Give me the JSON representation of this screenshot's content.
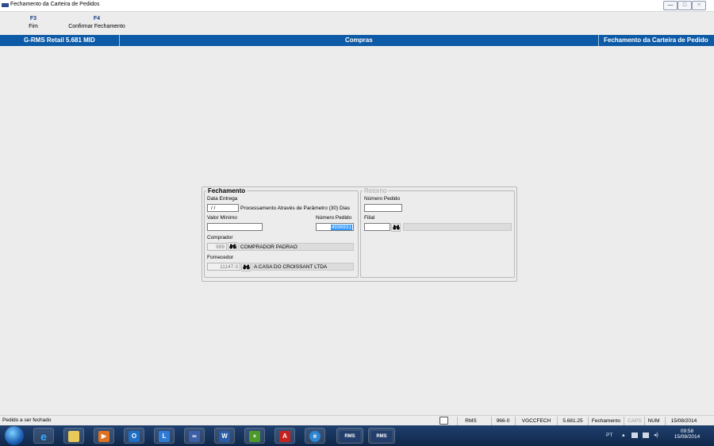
{
  "window": {
    "title": "Fechamento da Carteira de Pedidos",
    "btn_min": "—",
    "btn_max": "□",
    "btn_close": "✕"
  },
  "function_keys": [
    {
      "key": "F3",
      "label": "Fim"
    },
    {
      "key": "F4",
      "label": "Confirmar Fechamento"
    }
  ],
  "header": {
    "app": "G-RMS Retail 5.681 MID",
    "module": "Compras",
    "screen": "Fechamento da Carteira de Pedido"
  },
  "fechamento": {
    "title": "Fechamento",
    "data_entrega_label": "Data Entrega",
    "data_entrega_value": " / /",
    "processamento_text": "Processamento Através de Parâmetro (30) Dias",
    "valor_minimo_label": "Valor Mínimo",
    "valor_minimo_value": "",
    "numero_pedido_label": "Número Pedido",
    "numero_pedido_value": "4936931",
    "comprador_label": "Comprador",
    "comprador_code": "999",
    "comprador_name": "COMPRADOR PADRAO",
    "fornecedor_label": "Fornecedor",
    "fornecedor_code": "11147-3",
    "fornecedor_name": "A CASA DO CROISSANT LTDA"
  },
  "retorno": {
    "title": "Retorno",
    "numero_pedido_label": "Número Pedido",
    "filial_label": "Filial"
  },
  "status": {
    "message": "Pedido a ser fechado",
    "cells": [
      "RMS",
      "966-0",
      "VGCCFECH",
      "5.681.25",
      "Fechamento",
      "CAPS",
      "NUM",
      "15/08/2014"
    ]
  },
  "taskbar": {
    "apps": [
      "ie-icon",
      "explorer-icon",
      "media-icon",
      "outlook-icon",
      "lync-icon",
      "app-icon",
      "word-icon",
      "app2-icon",
      "acrobat-icon",
      "app3-icon",
      "rms-icon",
      "rms-icon-2"
    ],
    "rms_label": "RMS",
    "tray_text": "PT",
    "time": "09:58",
    "date": "15/08/2014"
  }
}
